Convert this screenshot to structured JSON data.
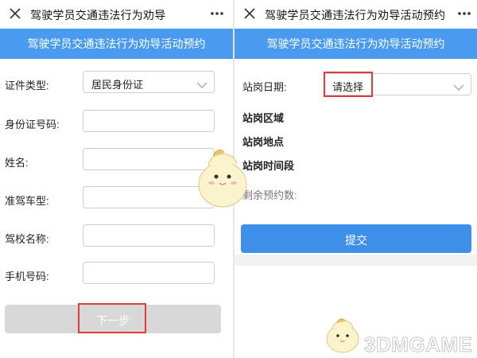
{
  "left": {
    "title": "驾驶学员交通违法行为劝导",
    "banner": "驾驶学员交通违法行为劝导活动预约",
    "fields": [
      {
        "label": "证件类型:",
        "value": "居民身份证"
      },
      {
        "label": "身份证号码:",
        "value": ""
      },
      {
        "label": "姓名:",
        "value": ""
      },
      {
        "label": "准驾车型:",
        "value": ""
      },
      {
        "label": "驾校名称:",
        "value": ""
      },
      {
        "label": "手机号码:",
        "value": ""
      }
    ],
    "next_label": "下一步"
  },
  "right": {
    "title": "驾驶学员交通违法行为劝导活动预约",
    "banner": "驾驶学员交通违法行为劝导活动预约",
    "date_label": "站岗日期:",
    "date_placeholder": "请选择",
    "area_label": "站岗区域",
    "place_label": "站岗地点",
    "time_label": "站岗时间段",
    "remaining_label": "剩余预约数:",
    "submit_label": "提交"
  },
  "watermark": "3DMGAME",
  "colors": {
    "banner": "#4a9bf0",
    "submit": "#3d8fe8",
    "next_disabled": "#d8d8d8",
    "highlight": "#e23a3a"
  },
  "icons": {
    "close": "close-icon",
    "more": "more-dots-icon",
    "dropdown": "chevron-down-icon"
  }
}
